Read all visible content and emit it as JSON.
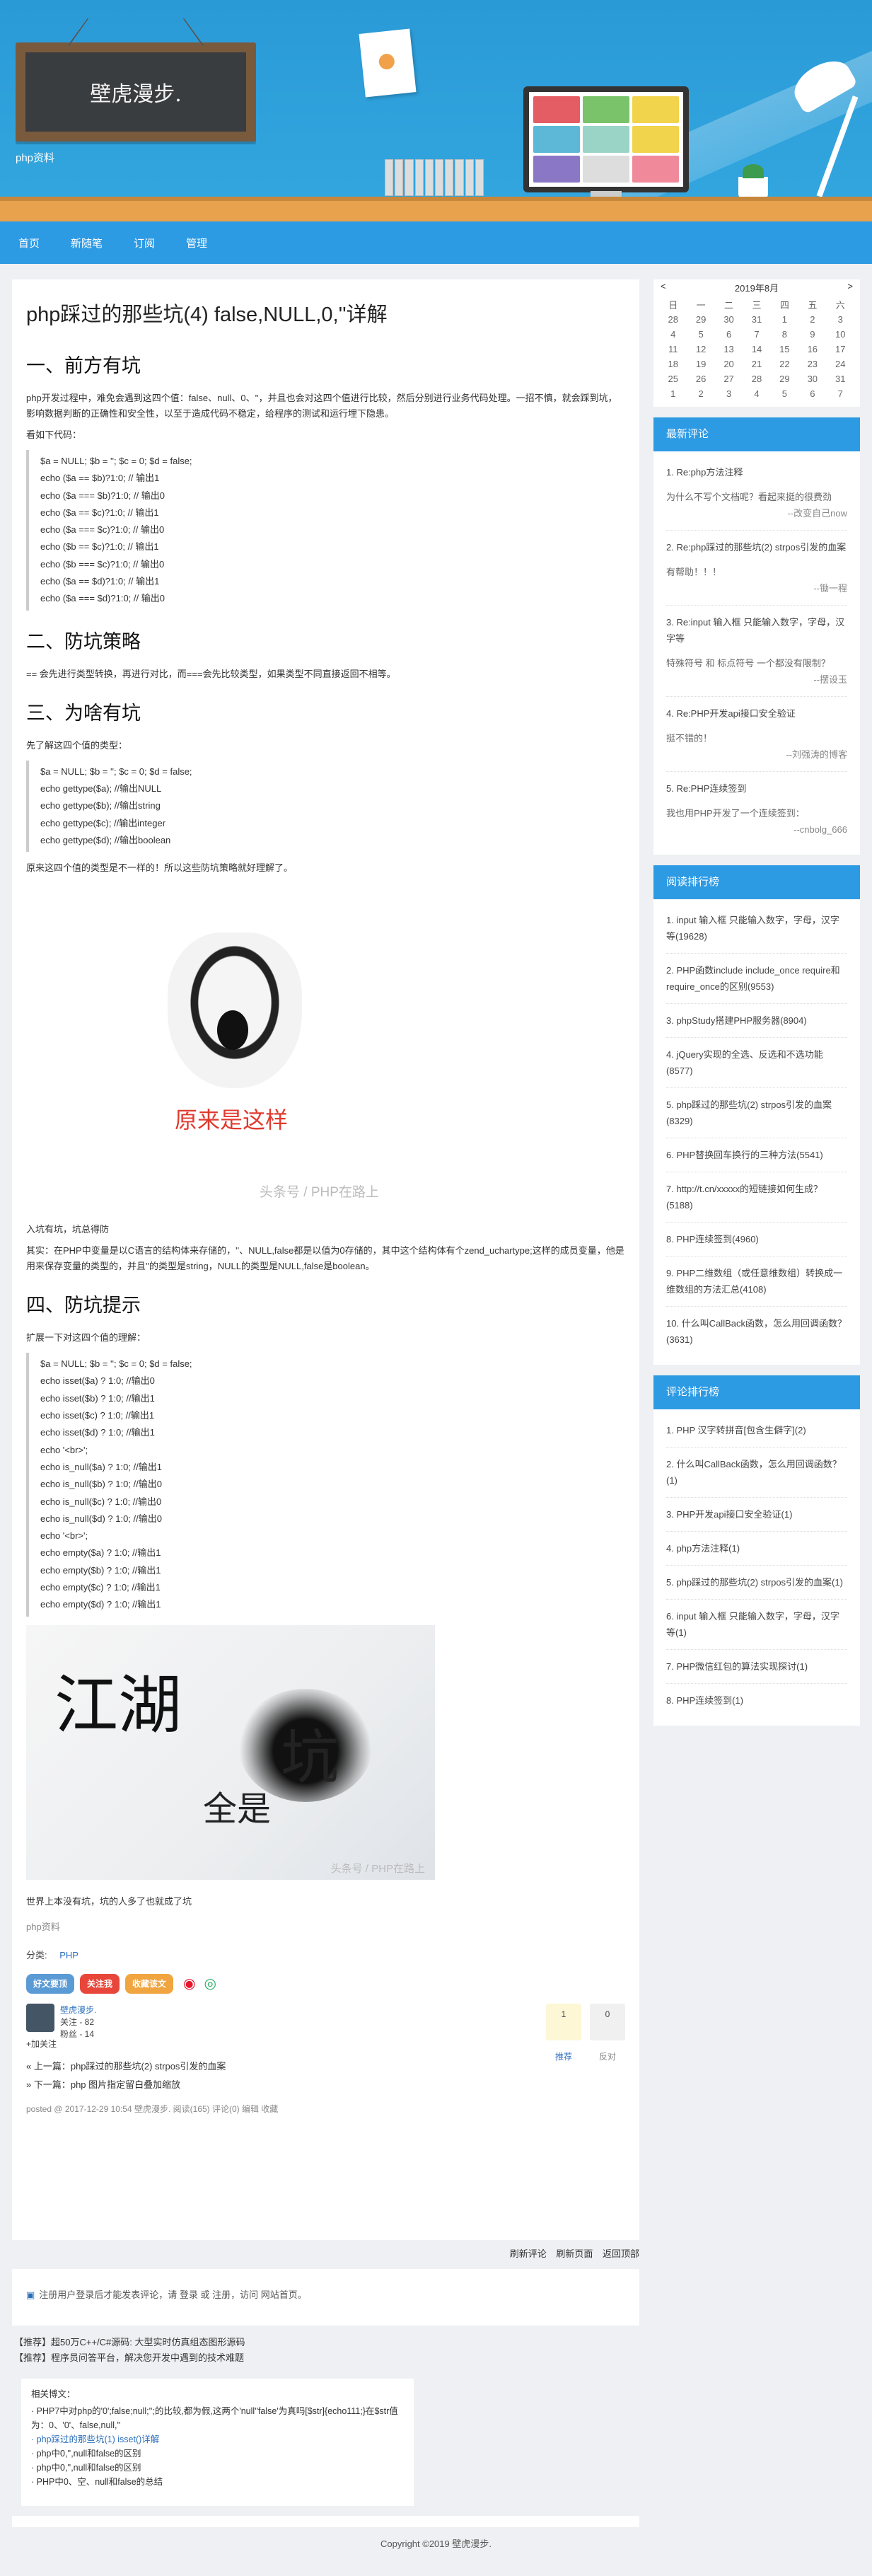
{
  "header": {
    "site_title": "壁虎漫步.",
    "site_subtitle": "php资料"
  },
  "nav": [
    "首页",
    "新随笔",
    "订阅",
    "管理"
  ],
  "post": {
    "title": "php踩过的那些坑(4) false,NULL,0,''详解",
    "sections": {
      "s1": "一、前方有坑",
      "s2": "二、防坑策略",
      "s3": "三、为啥有坑",
      "s4": "四、防坑提示"
    },
    "p1": "php开发过程中，难免会遇到这四个值：false、null、0、''，并且也会对这四个值进行比较，然后分别进行业务代码处理。一招不慎，就会踩到坑，影响数据判断的正确性和安全性，以至于造成代码不稳定，给程序的测试和运行埋下隐患。",
    "p2": "看如下代码：",
    "code1": [
      "$a = NULL; $b = ''; $c = 0; $d = false;",
      "echo ($a == $b)?1:0; // 输出1",
      "echo ($a === $b)?1:0; // 输出0",
      "echo ($a == $c)?1:0; // 输出1",
      "echo ($a === $c)?1:0; // 输出0",
      "echo ($b == $c)?1:0; // 输出1",
      "echo ($b === $c)?1:0; // 输出0",
      "echo ($a == $d)?1:0; // 输出1",
      "echo ($a === $d)?1:0; // 输出0"
    ],
    "p3": "== 会先进行类型转换，再进行对比，而===会先比较类型，如果类型不同直接返回不相等。",
    "p4": "先了解这四个值的类型：",
    "code2": [
      "$a = NULL; $b = ''; $c = 0; $d = false;",
      "echo gettype($a); //输出NULL",
      "echo gettype($b); //输出string",
      "echo gettype($c); //输出integer",
      "echo gettype($d); //输出boolean"
    ],
    "p5": "原来这四个值的类型是不一样的！所以这些防坑策略就好理解了。",
    "meme_caption": "原来是这样",
    "watermark": "头条号 / PHP在路上",
    "p6": "入坑有坑，坑总得防",
    "p7": "其实：在PHP中变量是以C语言的结构体来存储的，''、NULL,false都是以值为0存储的，其中这个结构体有个zend_uchartype;这样的成员变量，他是用来保存变量的类型的，并且''的类型是string，NULL的类型是NULL,false是boolean。",
    "p8": "扩展一下对这四个值的理解：",
    "code3": [
      "$a = NULL; $b = ''; $c = 0; $d = false;",
      "echo isset($a) ? 1:0; //输出0",
      "echo isset($b) ? 1:0; //输出1",
      "echo isset($c) ? 1:0; //输出1",
      "echo isset($d) ? 1:0; //输出1",
      "echo '<br>';",
      "echo is_null($a) ? 1:0; //输出1",
      "echo is_null($b) ? 1:0; //输出0",
      "echo is_null($c) ? 1:0; //输出0",
      "echo is_null($d) ? 1:0; //输出0",
      "echo '<br>';",
      "echo empty($a) ? 1:0; //输出1",
      "echo empty($b) ? 1:0; //输出1",
      "echo empty($c) ? 1:0; //输出1",
      "echo empty($d) ? 1:0; //输出1"
    ],
    "img2": {
      "c1": "江湖",
      "c2": "坑",
      "c3": "全是",
      "wm": "头条号 / PHP在路上"
    },
    "p9": "世界上本没有坑，坑的人多了也就成了坑",
    "p10": "php资料",
    "category_label": "分类:",
    "category": "PHP",
    "share_buttons": [
      {
        "label": "好文要顶",
        "color": "#5b9bd5"
      },
      {
        "label": "关注我",
        "color": "#e8463a"
      },
      {
        "label": "收藏该文",
        "color": "#f0a540"
      }
    ],
    "author": {
      "name": "壁虎漫步.",
      "fans": "关注 - 82",
      "follow": "粉丝 - 14",
      "add": "+加关注"
    },
    "digg": {
      "up": "1",
      "up_label": "推荐",
      "down": "0",
      "down_label": "反对"
    },
    "prev": "« 上一篇：php踩过的那些坑(2) strpos引发的血案",
    "next": "» 下一篇：php 图片指定留白叠加缩放",
    "postdesc": "posted @ 2017-12-29 10:54 壁虎漫步. 阅读(165) 评论(0) 编辑 收藏"
  },
  "commentbar": {
    "links": [
      "刷新评论",
      "刷新页面",
      "返回顶部"
    ],
    "login": "注册用户登录后才能发表评论，请 登录 或 注册，访问 网站首页。"
  },
  "ads": [
    "【推荐】超50万C++/C#源码: 大型实时仿真组态图形源码",
    "【推荐】程序员问答平台，解决您开发中遇到的技术难题"
  ],
  "related": {
    "title": "相关博文：",
    "items": [
      "· PHP7中对php的'0';false;null;'';的比较,都为假,这两个'null''false'为真吗[$str]{echo111;}在$str值为：0、'0'、false,null,''",
      "· php踩过的那些坑(1) isset()详解",
      "· php中0,'',null和false的区别",
      "· php中0,'',null和false的区别",
      "· PHP中0、空、null和false的总结"
    ]
  },
  "calendar": {
    "title": "2019年8月",
    "weekdays": [
      "日",
      "一",
      "二",
      "三",
      "四",
      "五",
      "六"
    ],
    "rows": [
      [
        "28",
        "29",
        "30",
        "31",
        "1",
        "2",
        "3"
      ],
      [
        "4",
        "5",
        "6",
        "7",
        "8",
        "9",
        "10"
      ],
      [
        "11",
        "12",
        "13",
        "14",
        "15",
        "16",
        "17"
      ],
      [
        "18",
        "19",
        "20",
        "21",
        "22",
        "23",
        "24"
      ],
      [
        "25",
        "26",
        "27",
        "28",
        "29",
        "30",
        "31"
      ],
      [
        "1",
        "2",
        "3",
        "4",
        "5",
        "6",
        "7"
      ]
    ]
  },
  "recent_comments": {
    "title": "最新评论",
    "items": [
      {
        "t": "1. Re:php方法注释",
        "b": "为什么不写个文档呢？看起来挺的很费劲",
        "by": "--改变自己now"
      },
      {
        "t": "2. Re:php踩过的那些坑(2) strpos引发的血案",
        "b": "有帮助！！！",
        "by": "--锄一程"
      },
      {
        "t": "3. Re:input 输入框 只能输入数字，字母，汉字等",
        "b": "特殊符号 和 标点符号 一个都没有限制？",
        "by": "--摆设玉"
      },
      {
        "t": "4. Re:PHP开发api接口安全验证",
        "b": "挺不错的！",
        "by": "--刘强涛的博客"
      },
      {
        "t": "5. Re:PHP连续签到",
        "b": "我也用PHP开发了一个连续签到：",
        "by": "--cnbolg_666"
      }
    ]
  },
  "read_rank": {
    "title": "阅读排行榜",
    "items": [
      "1. input 输入框 只能输入数字，字母，汉字等(19628)",
      "2. PHP函数include include_once require和require_once的区别(9553)",
      "3. phpStudy搭建PHP服务器(8904)",
      "4. jQuery实现的全选、反选和不选功能(8577)",
      "5. php踩过的那些坑(2) strpos引发的血案(8329)",
      "6. PHP替换回车换行的三种方法(5541)",
      "7. http://t.cn/xxxxx的短链接如何生成？(5188)",
      "8. PHP连续签到(4960)",
      "9. PHP二维数组（或任意维数组）转换成一维数组的方法汇总(4108)",
      "10. 什么叫CallBack函数，怎么用回调函数？(3631)"
    ]
  },
  "comment_rank": {
    "title": "评论排行榜",
    "items": [
      "1. PHP 汉字转拼音[包含生僻字](2)",
      "2. 什么叫CallBack函数，怎么用回调函数？(1)",
      "3. PHP开发api接口安全验证(1)",
      "4. php方法注释(1)",
      "5. php踩过的那些坑(2) strpos引发的血案(1)",
      "6. input 输入框 只能输入数字，字母，汉字等(1)",
      "7. PHP微信红包的算法实现探讨(1)",
      "8. PHP连续签到(1)"
    ]
  },
  "footer": "Copyright ©2019 壁虎漫步."
}
